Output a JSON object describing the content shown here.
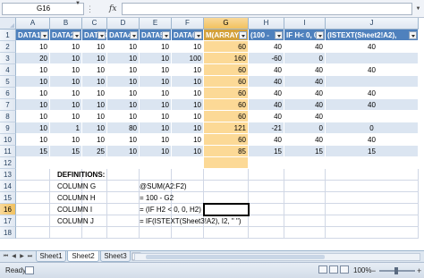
{
  "formula_bar": {
    "name_box": "G16",
    "fx_label": "fx",
    "formula": ""
  },
  "columns": [
    "A",
    "B",
    "C",
    "D",
    "E",
    "F",
    "G",
    "H",
    "I",
    "J"
  ],
  "selected_column": "G",
  "rows": [
    "1",
    "2",
    "3",
    "4",
    "5",
    "6",
    "7",
    "8",
    "9",
    "10",
    "11",
    "12",
    "13",
    "14",
    "15",
    "16",
    "17",
    "18"
  ],
  "selected_row": "16",
  "table": {
    "headers": [
      "DATA1",
      "DATA2",
      "DATA3",
      "DATA4",
      "DATA5",
      "DATA6",
      "M(ARRAY",
      "(100 -",
      "IF H< 0, 0,",
      "(ISTEXT(Sheet2!A2),"
    ],
    "rows": [
      [
        "10",
        "10",
        "10",
        "10",
        "10",
        "10",
        "60",
        "40",
        "40",
        "40"
      ],
      [
        "20",
        "10",
        "10",
        "10",
        "10",
        "100",
        "160",
        "-60",
        "0",
        ""
      ],
      [
        "10",
        "10",
        "10",
        "10",
        "10",
        "10",
        "60",
        "40",
        "40",
        "40"
      ],
      [
        "10",
        "10",
        "10",
        "10",
        "10",
        "10",
        "60",
        "40",
        "40",
        ""
      ],
      [
        "10",
        "10",
        "10",
        "10",
        "10",
        "10",
        "60",
        "40",
        "40",
        "40"
      ],
      [
        "10",
        "10",
        "10",
        "10",
        "10",
        "10",
        "60",
        "40",
        "40",
        "40"
      ],
      [
        "10",
        "10",
        "10",
        "10",
        "10",
        "10",
        "60",
        "40",
        "40",
        ""
      ],
      [
        "10",
        "1",
        "10",
        "80",
        "10",
        "10",
        "121",
        "-21",
        "0",
        "0"
      ],
      [
        "10",
        "10",
        "10",
        "10",
        "10",
        "10",
        "60",
        "40",
        "40",
        "40"
      ],
      [
        "15",
        "15",
        "25",
        "10",
        "10",
        "10",
        "85",
        "15",
        "15",
        "15"
      ]
    ]
  },
  "definitions": {
    "title": "DEFINITIONS:",
    "items": [
      {
        "label": "COLUMN G",
        "formula": "@SUM(A2:F2)"
      },
      {
        "label": "COLUMN H",
        "formula": "= 100 - G2"
      },
      {
        "label": "COLUMN I",
        "formula": "= (IF H2 < 0, 0, H2)"
      },
      {
        "label": "COLUMN J",
        "formula": "= IF(ISTEXT(Sheet3!A2), I2, \" \")"
      }
    ]
  },
  "sheet_tabs": [
    "Sheet1",
    "Sheet2",
    "Sheet3"
  ],
  "active_sheet": "Sheet2",
  "status": {
    "ready": "Ready",
    "zoom": "100%"
  },
  "colors": {
    "header_fill": "#4f81bd",
    "band_fill": "#dbe5f1",
    "selection": "#f1c15f"
  }
}
